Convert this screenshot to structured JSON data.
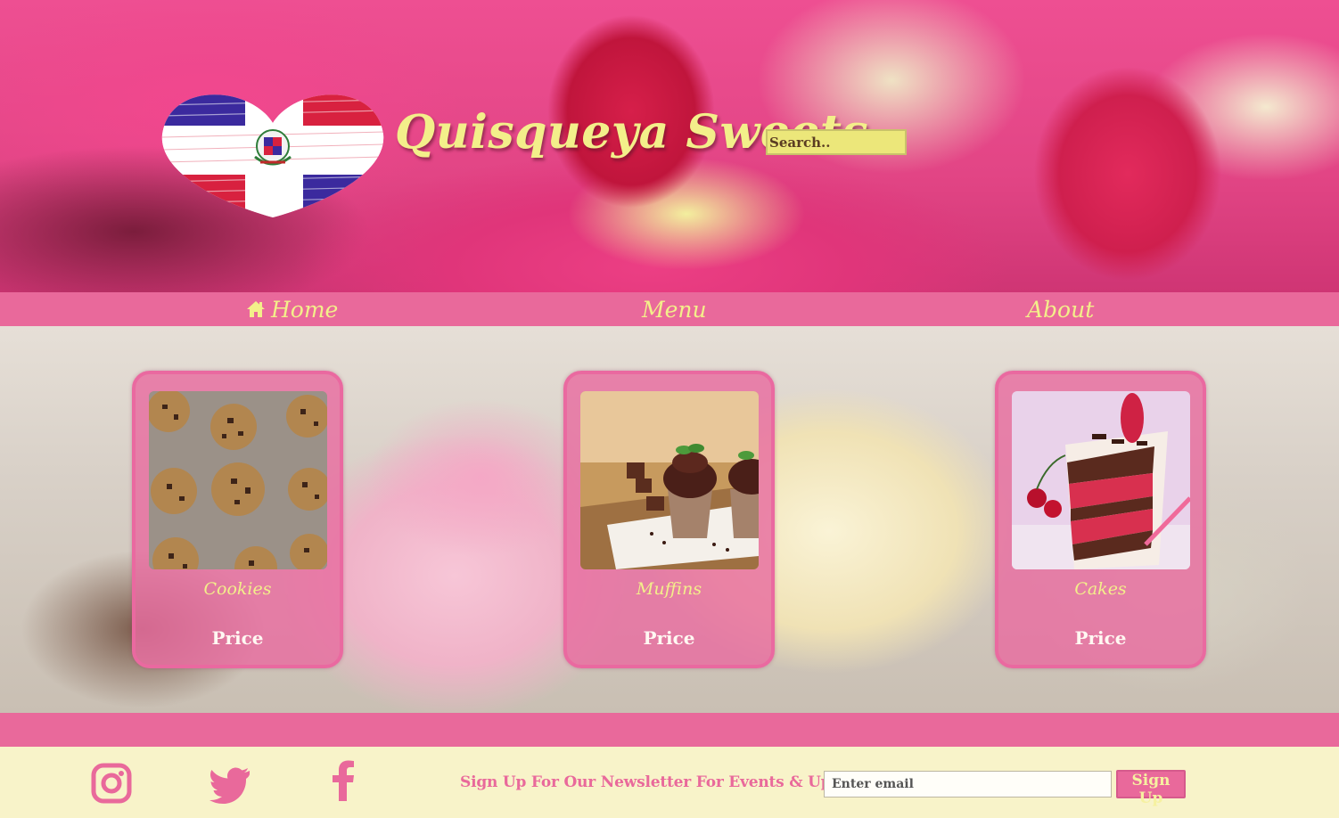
{
  "brand": {
    "name": "Quisqueya Sweets",
    "logo_icon": "dominican-flag-heart-icon"
  },
  "search": {
    "placeholder": "Search.."
  },
  "nav": {
    "items": [
      {
        "label": "Home",
        "icon": "home-icon"
      },
      {
        "label": "Menu"
      },
      {
        "label": "About"
      }
    ]
  },
  "cards": [
    {
      "name": "Cookies",
      "price_label": "Price"
    },
    {
      "name": "Muffins",
      "price_label": "Price"
    },
    {
      "name": "Cakes",
      "price_label": "Price"
    }
  ],
  "footer": {
    "social": [
      "instagram-icon",
      "twitter-icon",
      "facebook-icon"
    ],
    "newsletter_label": "Sign Up For Our Newsletter For Events & Updates:",
    "email_placeholder": "Enter email",
    "signup_label": "Sign Up"
  },
  "colors": {
    "accent_pink": "#e9699b",
    "accent_yellow": "#f3ef8a",
    "footer_bg": "#f8f3c9"
  }
}
